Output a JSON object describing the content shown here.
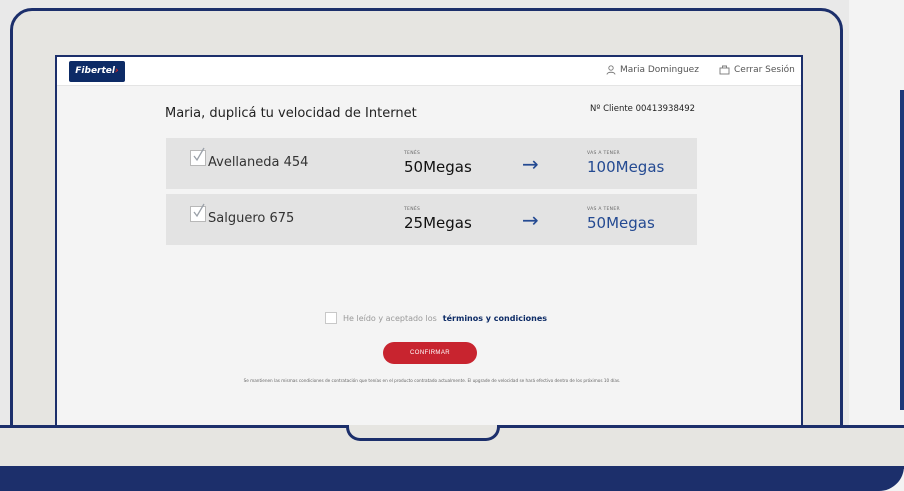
{
  "topbar": {
    "logo_text": "Fibertel",
    "user_name": "Maria Dominguez",
    "logout_label": "Cerrar Sesión"
  },
  "main": {
    "headline": "Maria, duplicá tu velocidad de Internet",
    "client_number": "Nº Cliente 00413938492"
  },
  "plans": [
    {
      "address": "Avellaneda 454",
      "current_label": "TENÉS",
      "current_speed": "50Megas",
      "new_label": "VAS A TENER",
      "new_speed": "100Megas"
    },
    {
      "address": "Salguero 675",
      "current_label": "TENÉS",
      "current_speed": "25Megas",
      "new_label": "VAS A TENER",
      "new_speed": "50Megas"
    }
  ],
  "terms": {
    "prefix": "He leído y aceptado los",
    "link": "términos y condiciones"
  },
  "confirm_label": "CONFIRMAR",
  "footnote": "Se mantienen las mismas condiciones de contratación que tenías en el producto contratado actualmente. El upgrade de velocidad se hará efectivo dentro de los próximos 10 días.",
  "colors": {
    "frame": "#1c2f6b",
    "brand_blue": "#0d2b66",
    "speed_blue": "#244a92",
    "confirm_red": "#c8242f"
  }
}
